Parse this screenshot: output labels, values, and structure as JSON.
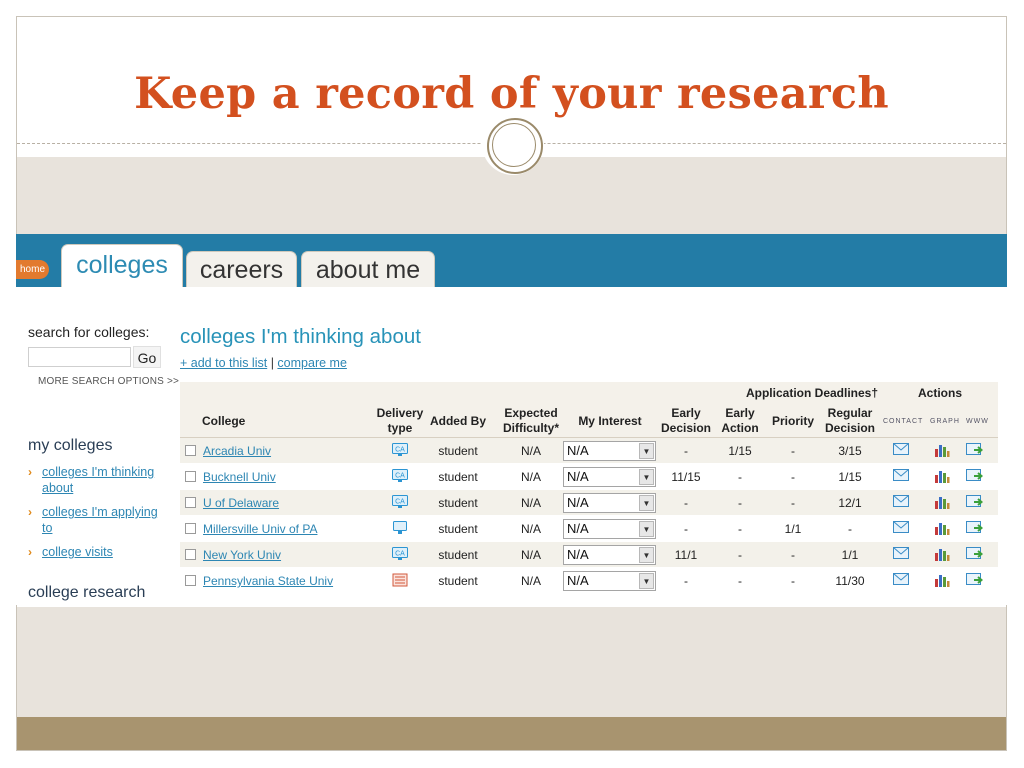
{
  "slide": {
    "title": "Keep a record of  your research"
  },
  "nav": {
    "home": "home",
    "tabs": [
      "colleges",
      "careers",
      "about me"
    ]
  },
  "sidebar": {
    "search_label": "search for colleges:",
    "go": "Go",
    "more_options": "MORE SEARCH OPTIONS >>",
    "my_colleges": "my colleges",
    "links": [
      [
        "colleges I'm thinking",
        "about"
      ],
      [
        "colleges I'm applying",
        "to"
      ],
      [
        "college visits"
      ]
    ],
    "college_research": "college research"
  },
  "main": {
    "title": "colleges I'm thinking about",
    "add_link": "+ add to this list",
    "separator": "|",
    "compare_link": "compare me"
  },
  "table": {
    "group_headers": {
      "deadlines": "Application Deadlines†",
      "actions": "Actions"
    },
    "headers": {
      "college": "College",
      "delivery": [
        "Delivery",
        "type"
      ],
      "added_by": "Added By",
      "difficulty": [
        "Expected",
        "Difficulty*"
      ],
      "interest": "My Interest",
      "early_decision": [
        "Early",
        "Decision"
      ],
      "early_action": [
        "Early",
        "Action"
      ],
      "priority": "Priority",
      "regular": [
        "Regular",
        "Decision"
      ],
      "contact": "CONTACT",
      "graph": "GRAPH",
      "www": "WWW"
    },
    "rows": [
      {
        "college": "Arcadia Univ",
        "delivery_icon": "common-app-icon",
        "added_by": "student",
        "difficulty": "N/A",
        "interest": "N/A",
        "early_decision": "-",
        "early_action": "1/15",
        "priority": "-",
        "regular": "3/15"
      },
      {
        "college": "Bucknell Univ",
        "delivery_icon": "common-app-icon",
        "added_by": "student",
        "difficulty": "N/A",
        "interest": "N/A",
        "early_decision": "11/15",
        "early_action": "-",
        "priority": "-",
        "regular": "1/15"
      },
      {
        "college": "U of Delaware",
        "delivery_icon": "common-app-icon",
        "added_by": "student",
        "difficulty": "N/A",
        "interest": "N/A",
        "early_decision": "-",
        "early_action": "-",
        "priority": "-",
        "regular": "12/1"
      },
      {
        "college": "Millersville Univ of PA",
        "delivery_icon": "monitor-icon",
        "added_by": "student",
        "difficulty": "N/A",
        "interest": "N/A",
        "early_decision": "-",
        "early_action": "-",
        "priority": "1/1",
        "regular": "-"
      },
      {
        "college": "New York Univ",
        "delivery_icon": "common-app-icon",
        "added_by": "student",
        "difficulty": "N/A",
        "interest": "N/A",
        "early_decision": "11/1",
        "early_action": "-",
        "priority": "-",
        "regular": "1/1"
      },
      {
        "college": "Pennsylvania State Univ",
        "delivery_icon": "paper-app-icon",
        "added_by": "student",
        "difficulty": "N/A",
        "interest": "N/A",
        "early_decision": "-",
        "early_action": "-",
        "priority": "-",
        "regular": "11/30"
      }
    ],
    "action_icons": [
      "envelope-icon",
      "bar-graph-icon",
      "web-link-icon"
    ]
  },
  "colors": {
    "title": "#d3501f",
    "nav": "#237ca6",
    "link": "#2d86b3",
    "home": "#e27a2e",
    "band": "#e8e3dc",
    "footer": "#a8946f"
  }
}
